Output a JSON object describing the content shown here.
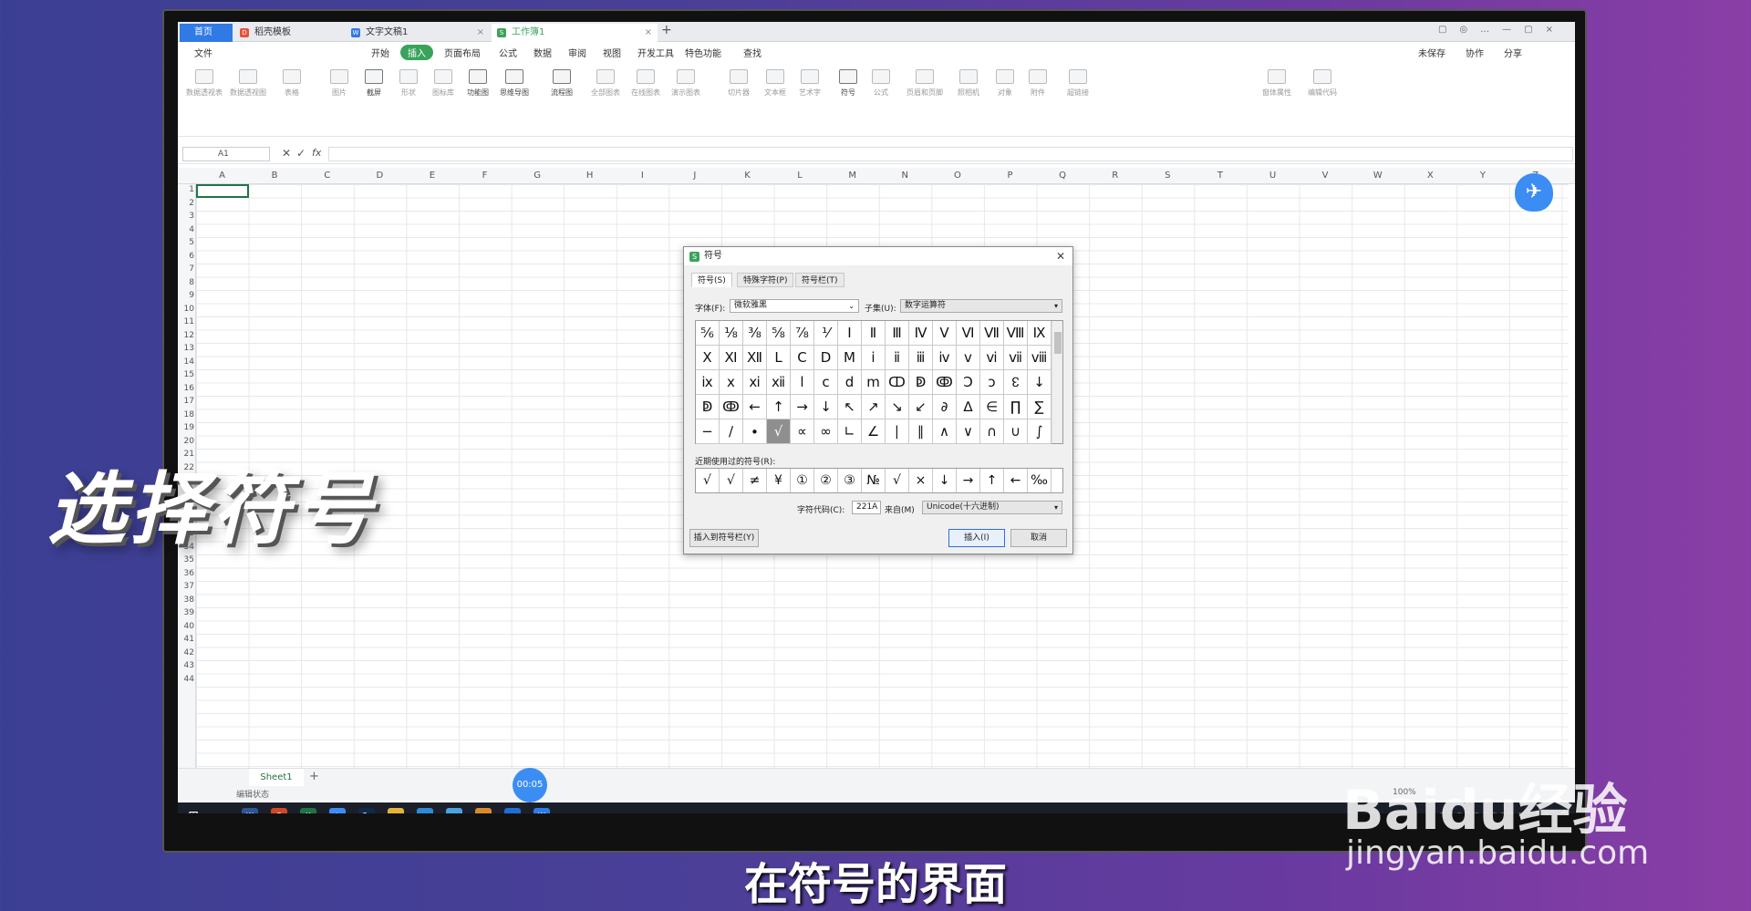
{
  "tabs": [
    {
      "label": "首页",
      "icon": "home"
    },
    {
      "label": "稻壳模板",
      "icon": "docer-icon"
    },
    {
      "label": "文字文稿1",
      "icon": "writer-icon"
    },
    {
      "label": "工作簿1",
      "icon": "sheet-icon"
    }
  ],
  "menu": [
    "文件",
    "开始",
    "插入",
    "页面布局",
    "公式",
    "数据",
    "审阅",
    "视图",
    "开发工具",
    "特色功能",
    "查找"
  ],
  "menu_right": [
    "未保存",
    "协作",
    "分享"
  ],
  "ribbon": [
    "数据透视表",
    "数据透视图",
    "表格",
    "图片",
    "截屏",
    "形状",
    "图标库",
    "功能图",
    "思维导图",
    "流程图",
    "全部图表",
    "在线图表",
    "演示图表",
    "切片器",
    "文本框",
    "艺术字",
    "符号",
    "公式",
    "页眉和页脚",
    "照相机",
    "对象",
    "附件",
    "超链接",
    "窗体属性",
    "编辑代码"
  ],
  "formula": {
    "cell_ref": "A1",
    "fx": "fx"
  },
  "columns": [
    "A",
    "B",
    "C",
    "D",
    "E",
    "F",
    "G",
    "H",
    "I",
    "J",
    "K",
    "L",
    "M",
    "N",
    "O",
    "P",
    "Q",
    "R",
    "S",
    "T",
    "U",
    "V",
    "W",
    "X",
    "Y",
    "Z"
  ],
  "rows": [
    "1",
    "2",
    "3",
    "4",
    "5",
    "6",
    "7",
    "8",
    "9",
    "10",
    "11",
    "12",
    "13",
    "14",
    "15",
    "16",
    "17",
    "18",
    "19",
    "20",
    "21",
    "22",
    "29",
    "30",
    "31",
    "32",
    "33",
    "34",
    "35",
    "36",
    "37",
    "38",
    "39",
    "40",
    "41",
    "42",
    "43",
    "44"
  ],
  "sheet": {
    "tab": "Sheet1",
    "add": "+"
  },
  "status": {
    "mode": "编辑状态",
    "zoom": "100%"
  },
  "timer": "00:05",
  "dialog": {
    "title": "符号",
    "tabs": [
      "符号(S)",
      "特殊字符(P)",
      "符号栏(T)"
    ],
    "font_label": "字体(F):",
    "font_value": "微软雅黑",
    "subset_label": "子集(U):",
    "subset_value": "数字运算符",
    "symbols": [
      [
        "⅚",
        "⅛",
        "⅜",
        "⅝",
        "⅞",
        "⅟",
        "Ⅰ",
        "Ⅱ",
        "Ⅲ",
        "Ⅳ",
        "Ⅴ",
        "Ⅵ",
        "Ⅶ",
        "Ⅷ",
        "Ⅸ"
      ],
      [
        "Ⅹ",
        "Ⅺ",
        "Ⅻ",
        "Ⅼ",
        "Ⅽ",
        "Ⅾ",
        "Ⅿ",
        "ⅰ",
        "ⅱ",
        "ⅲ",
        "ⅳ",
        "ⅴ",
        "ⅵ",
        "ⅶ",
        "ⅷ"
      ],
      [
        "ⅸ",
        "ⅹ",
        "ⅺ",
        "ⅻ",
        "ⅼ",
        "ⅽ",
        "ⅾ",
        "ⅿ",
        "ↀ",
        "ↁ",
        "ↂ",
        "Ↄ",
        "ↄ",
        "↋",
        "↓"
      ],
      [
        "ↁ",
        "ↂ",
        "←",
        "↑",
        "→",
        "↓",
        "↖",
        "↗",
        "↘",
        "↙",
        "∂",
        "∆",
        "∈",
        "∏",
        "∑"
      ],
      [
        "−",
        "∕",
        "∙",
        "√",
        "∝",
        "∞",
        "∟",
        "∠",
        "∣",
        "∥",
        "∧",
        "∨",
        "∩",
        "∪",
        "∫"
      ]
    ],
    "selected_symbol": "√",
    "recent_label": "近期使用过的符号(R):",
    "recent": [
      "√",
      "√",
      "≠",
      "¥",
      "①",
      "②",
      "③",
      "№",
      "√",
      "×",
      "↓",
      "→",
      "↑",
      "←",
      "‰"
    ],
    "code_label": "字符代码(C):",
    "code_value": "221A",
    "from_label": "来自(M)",
    "from_value": "Unicode(十六进制)",
    "btn_toolbar": "插入到符号栏(Y)",
    "btn_insert": "插入(I)",
    "btn_cancel": "取消"
  },
  "caption_big": "选择符号",
  "subtitle": "在符号的界面",
  "watermark": {
    "brand": "Baidu经验",
    "url": "jingyan.baidu.com"
  },
  "colors": {
    "accent_blue": "#2f7ae5",
    "insert_green": "#3aa35b",
    "excel_green": "#217346"
  }
}
